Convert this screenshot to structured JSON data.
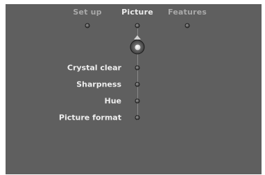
{
  "tabs": [
    {
      "label": "Set up",
      "active": false
    },
    {
      "label": "Picture",
      "active": true
    },
    {
      "label": "Features",
      "active": false
    }
  ],
  "menu": {
    "items": [
      {
        "label": "Crystal clear"
      },
      {
        "label": "Sharpness"
      },
      {
        "label": "Hue"
      },
      {
        "label": "Picture format"
      }
    ]
  },
  "colors": {
    "background": "#5f5f5f",
    "active_text": "#ececec",
    "inactive_text": "#a9a9a9"
  }
}
